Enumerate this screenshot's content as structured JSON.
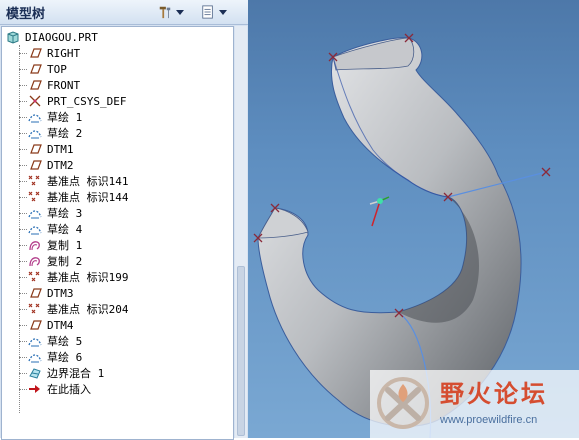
{
  "panel": {
    "title": "模型树",
    "tools_icon": "hammer-wrench-icon",
    "show_icon": "list-settings-icon"
  },
  "tree": {
    "root": {
      "label": "DIAOGOU.PRT",
      "icon": "part-icon"
    },
    "items": [
      {
        "label": "RIGHT",
        "icon": "datum-plane-icon"
      },
      {
        "label": "TOP",
        "icon": "datum-plane-icon"
      },
      {
        "label": "FRONT",
        "icon": "datum-plane-icon"
      },
      {
        "label": "PRT_CSYS_DEF",
        "icon": "csys-icon"
      },
      {
        "label": "草绘 1",
        "icon": "sketch-icon"
      },
      {
        "label": "草绘 2",
        "icon": "sketch-icon"
      },
      {
        "label": "DTM1",
        "icon": "datum-plane-icon"
      },
      {
        "label": "DTM2",
        "icon": "datum-plane-icon"
      },
      {
        "label": "基准点 标识141",
        "icon": "datum-point-icon"
      },
      {
        "label": "基准点 标识144",
        "icon": "datum-point-icon"
      },
      {
        "label": "草绘 3",
        "icon": "sketch-icon"
      },
      {
        "label": "草绘 4",
        "icon": "sketch-icon"
      },
      {
        "label": "复制 1",
        "icon": "copy-icon"
      },
      {
        "label": "复制 2",
        "icon": "copy-icon"
      },
      {
        "label": "基准点 标识199",
        "icon": "datum-point-icon"
      },
      {
        "label": "DTM3",
        "icon": "datum-plane-icon"
      },
      {
        "label": "基准点 标识204",
        "icon": "datum-point-icon"
      },
      {
        "label": "DTM4",
        "icon": "datum-plane-icon"
      },
      {
        "label": "草绘 5",
        "icon": "sketch-icon"
      },
      {
        "label": "草绘 6",
        "icon": "sketch-icon"
      },
      {
        "label": "边界混合 1",
        "icon": "boundary-blend-icon"
      },
      {
        "label": "在此插入",
        "icon": "insert-arrow-icon"
      }
    ]
  },
  "watermark": {
    "title": "野火论坛",
    "url": "www.proewildfire.cn"
  },
  "colors": {
    "viewport_top": "#4d78a9",
    "viewport_bottom": "#7aa8d3",
    "insert_arrow": "#c0141b",
    "watermark_text": "#d54d30"
  }
}
